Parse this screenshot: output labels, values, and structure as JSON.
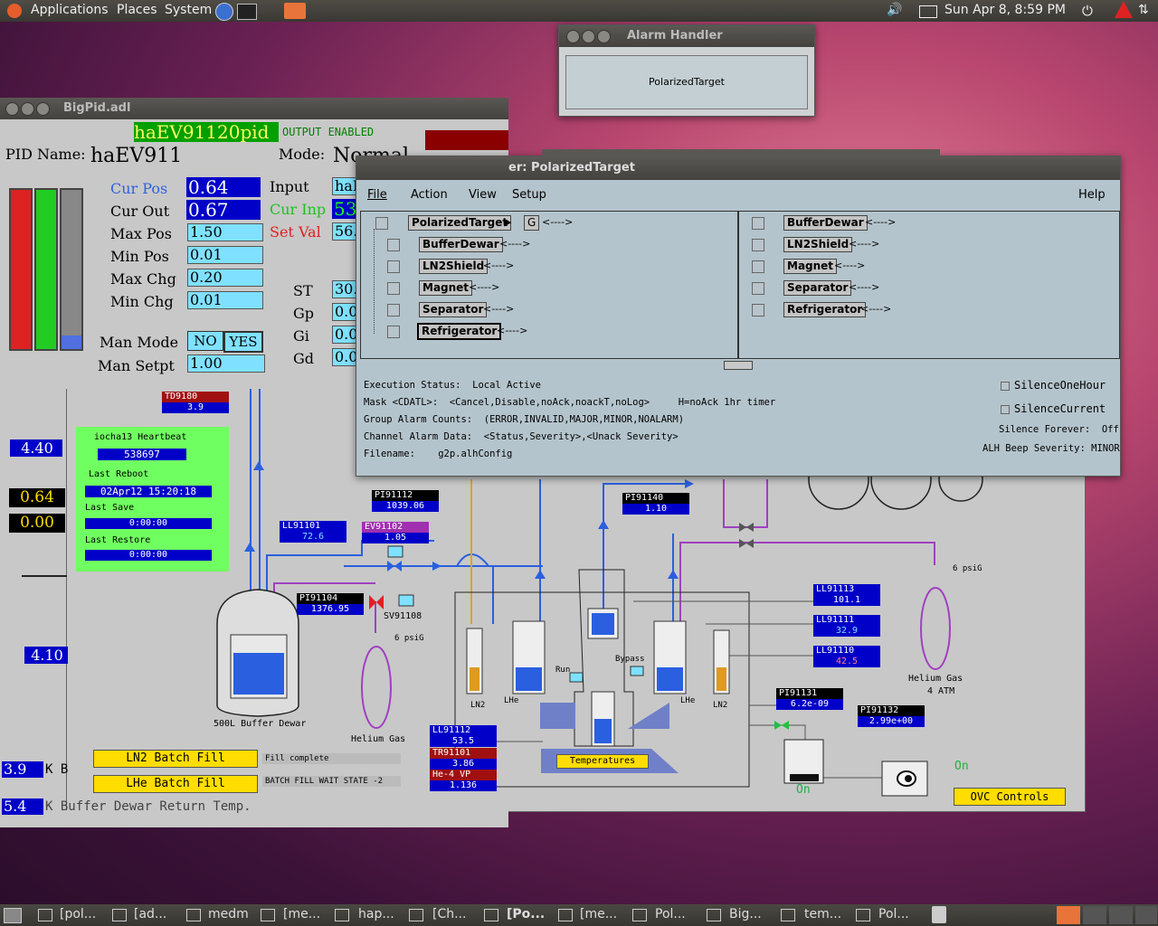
{
  "top_panel": {
    "menus": [
      "Applications",
      "Places",
      "System"
    ],
    "clock": "Sun Apr  8,  8:59 PM"
  },
  "alarm_handler": {
    "title": "Alarm Handler",
    "button": "PolarizedTarget"
  },
  "bigpid": {
    "title": "BigPid.adl",
    "pid_tag": "haEV91120pid",
    "output_status": "OUTPUT ENABLED",
    "pid_name_label": "PID Name:",
    "pid_name": "haEV911",
    "mode_label": "Mode:",
    "mode": "Normal",
    "cur_pos_label": "Cur Pos",
    "cur_pos": "0.64",
    "cur_out_label": "Cur Out",
    "cur_out": "0.67",
    "max_pos_label": "Max Pos",
    "max_pos": "1.50",
    "min_pos_label": "Min Pos",
    "min_pos": "0.01",
    "max_chg_label": "Max Chg",
    "max_chg": "0.20",
    "min_chg_label": "Min Chg",
    "min_chg": "0.01",
    "input_label": "Input",
    "input": "haL",
    "cur_inp_label": "Cur Inp",
    "cur_inp": "53",
    "set_val_label": "Set Val",
    "set_val": "56.",
    "st_label": "ST",
    "st": "30.",
    "gp_label": "Gp",
    "gp": "0.0",
    "gi_label": "Gi",
    "gi": "0.0",
    "gd_label": "Gd",
    "gd": "0.0",
    "man_mode_label": "Man Mode",
    "man_no": "NO",
    "man_yes": "YES",
    "man_setpt_label": "Man Setpt",
    "man_setpt": "1.00",
    "left_values": [
      "4.40",
      "0.64",
      "0.00",
      "4.10"
    ],
    "bottom_rows": [
      {
        "value": "3.9",
        "text": "K B"
      },
      {
        "value": "5.4",
        "text": "K Buffer Dewar Return Temp."
      }
    ]
  },
  "alh_main": {
    "title": "er: PolarizedTarget",
    "menus": [
      "File",
      "Action",
      "View",
      "Setup"
    ],
    "help": "Help",
    "tree_root": "PolarizedTarget",
    "tree_root_flag": "G",
    "arrow": "<---->",
    "tree_children": [
      "BufferDewar",
      "LN2Shield",
      "Magnet",
      "Separator",
      "Refrigerator"
    ],
    "right_list": [
      "BufferDewar",
      "LN2Shield",
      "Magnet",
      "Separator",
      "Refrigerator"
    ],
    "exec_status_label": "Execution Status:",
    "exec_status": "Local Active",
    "mask_label": "Mask <CDATL>:",
    "mask": "<Cancel,Disable,noAck,noackT,noLog>",
    "mask_note": "H=noAck 1hr timer",
    "group_label": "Group Alarm Counts:",
    "group": "(ERROR,INVALID,MAJOR,MINOR,NOALARM)",
    "channel_label": "Channel Alarm Data:",
    "channel": "<Status,Severity>,<Unack Severity>",
    "filename_label": "Filename:",
    "filename": "g2p.alhConfig",
    "silence_hour": "SilenceOneHour",
    "silence_current": "SilenceCurrent",
    "silence_forever_label": "Silence Forever:",
    "silence_forever": "Off",
    "beep_label": "ALH Beep Severity:",
    "beep": "MINOR"
  },
  "synoptic": {
    "td9180": {
      "name": "TD9180",
      "value": "3.9"
    },
    "heartbeat": {
      "title": "iocha13 Heartbeat",
      "count": "538697",
      "reboot_label": "Last Reboot",
      "reboot": "02Apr12 15:20:18",
      "save_label": "Last Save",
      "save": "0:00:00",
      "restore_label": "Last Restore",
      "restore": "0:00:00"
    },
    "tags": [
      {
        "name": "PI91112",
        "value": "1039.06"
      },
      {
        "name": "PI91140",
        "value": "1.10"
      },
      {
        "name": "LL91101",
        "value": "72.6"
      },
      {
        "name": "EV91102",
        "value": "1.05"
      },
      {
        "name": "PI91104",
        "value": "1376.95"
      },
      {
        "name": "LL91113",
        "value": "101.1"
      },
      {
        "name": "LL91111",
        "value": "32.9"
      },
      {
        "name": "LL91110",
        "value": "42.5"
      },
      {
        "name": "PI91131",
        "value": "6.2e-09"
      },
      {
        "name": "PI91132",
        "value": "2.99e+00"
      },
      {
        "name": "LL91112",
        "value": "53.5"
      },
      {
        "name": "TR91101",
        "value": "3.86"
      },
      {
        "name": "He-4 VP",
        "value": "1.136"
      }
    ],
    "sv_label": "SV91108",
    "psig_left": "6 psiG",
    "psig_right": "6 psiG",
    "dewar_label": "500L Buffer Dewar",
    "helium_gas": "Helium Gas",
    "helium_gas_right": "Helium Gas",
    "helium_atm": "4 ATM",
    "ln2_left": "LN2",
    "lhe_left": "LHe",
    "lhe_right": "LHe",
    "ln2_right": "LN2",
    "run": "Run",
    "bypass": "Bypass",
    "temperatures_btn": "Temperatures",
    "ln2_batch_btn": "LN2 Batch Fill",
    "ln2_status": "Fill complete",
    "lhe_batch_btn": "LHe Batch Fill",
    "lhe_status": "BATCH FILL WAIT STATE -2",
    "on1": "On",
    "on2": "On",
    "ovc_btn": "OVC Controls"
  },
  "taskbar": {
    "items": [
      "[pol...",
      "[ad...",
      "medm",
      "[me...",
      "hap...",
      "[Ch...",
      "[Po...",
      "[me...",
      "Pol...",
      "Big...",
      "tem...",
      "Pol..."
    ]
  },
  "colors": {
    "pid_blue": "#0000c8",
    "cyan_field": "#7fe1ff",
    "pipe_blue": "#2a5fe0",
    "pipe_purple": "#a040c0",
    "alh_bg": "#b4c4cc"
  }
}
